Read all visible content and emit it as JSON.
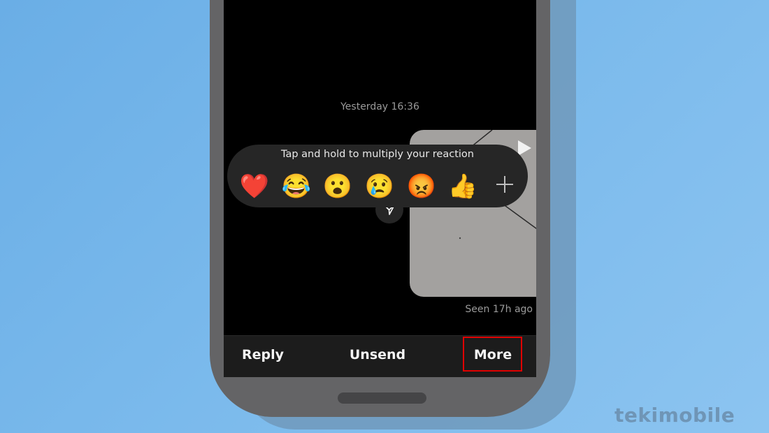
{
  "conversation": {
    "timestamp": "Yesterday 16:36",
    "seen_status": "Seen 17h ago"
  },
  "reaction_tray": {
    "hint": "Tap and hold to multiply your reaction",
    "emojis": [
      {
        "name": "heart",
        "glyph": "❤️"
      },
      {
        "name": "laughing-tears",
        "glyph": "😂"
      },
      {
        "name": "surprised",
        "glyph": "😮"
      },
      {
        "name": "crying",
        "glyph": "😢"
      },
      {
        "name": "angry",
        "glyph": "😡"
      },
      {
        "name": "thumbs-up",
        "glyph": "👍"
      }
    ],
    "more_icon": "plus-icon"
  },
  "media": {
    "play_icon": "play-icon",
    "share_icon": "send-icon"
  },
  "action_bar": {
    "reply": "Reply",
    "unsend": "Unsend",
    "more": "More"
  },
  "highlight_color": "#e00000",
  "watermark": "tekimobile"
}
